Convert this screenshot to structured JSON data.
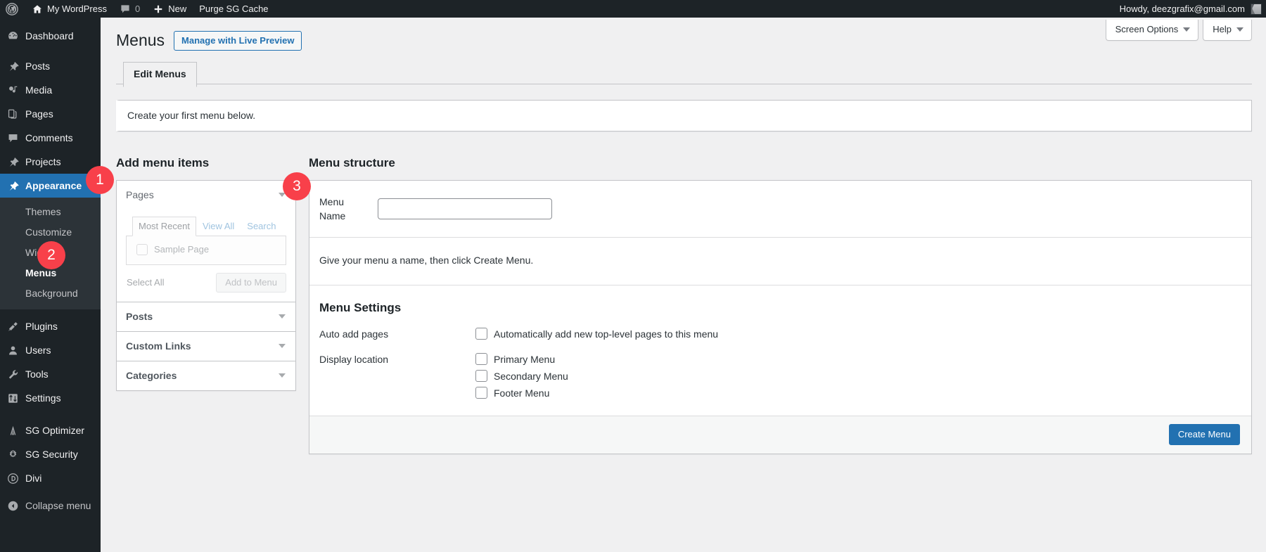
{
  "adminbar": {
    "logo_icon": "wordpress-logo-icon",
    "site_name": "My WordPress",
    "site_icon": "home-icon",
    "comments_icon": "comment-bubble-icon",
    "comments_count": "0",
    "new_icon": "plus-icon",
    "new_label": "New",
    "purge_label": "Purge SG Cache",
    "howdy": "Howdy, deezgrafix@gmail.com",
    "avatar": "user-avatar"
  },
  "sidebar": {
    "items": [
      {
        "label": "Dashboard",
        "icon": "dashboard-icon"
      },
      {
        "label": "Posts",
        "icon": "pin-icon"
      },
      {
        "label": "Media",
        "icon": "media-icon"
      },
      {
        "label": "Pages",
        "icon": "pages-icon"
      },
      {
        "label": "Comments",
        "icon": "comment-bubble-icon"
      },
      {
        "label": "Projects",
        "icon": "pin-icon"
      },
      {
        "label": "Appearance",
        "icon": "paintbrush-icon",
        "current": true
      },
      {
        "label": "Plugins",
        "icon": "plug-icon"
      },
      {
        "label": "Users",
        "icon": "user-icon"
      },
      {
        "label": "Tools",
        "icon": "wrench-icon"
      },
      {
        "label": "Settings",
        "icon": "settings-sliders-icon"
      },
      {
        "label": "SG Optimizer",
        "icon": "sg-optimizer-icon"
      },
      {
        "label": "SG Security",
        "icon": "gear-lock-icon"
      },
      {
        "label": "Divi",
        "icon": "divi-icon"
      }
    ],
    "appearance_submenu": [
      {
        "label": "Themes"
      },
      {
        "label": "Customize"
      },
      {
        "label": "Widgets"
      },
      {
        "label": "Menus",
        "current": true
      },
      {
        "label": "Background"
      }
    ],
    "collapse": {
      "label": "Collapse menu",
      "icon": "collapse-arrow-icon"
    }
  },
  "callouts": [
    {
      "number": "1"
    },
    {
      "number": "2"
    },
    {
      "number": "3"
    }
  ],
  "screen_meta": {
    "screen_options": "Screen Options",
    "help": "Help",
    "caret_icon": "caret-down-icon"
  },
  "header": {
    "title": "Menus",
    "live_preview_button": "Manage with Live Preview",
    "tabs": [
      {
        "label": "Edit Menus",
        "active": true
      }
    ]
  },
  "notice": {
    "text": "Create your first menu below."
  },
  "add_menu_items": {
    "heading": "Add menu items",
    "sections": [
      {
        "title": "Pages",
        "open": true,
        "caret_icon": "caret-down-icon",
        "tabs": [
          {
            "label": "Most Recent",
            "active": true
          },
          {
            "label": "View All",
            "active": false
          },
          {
            "label": "Search",
            "active": false
          }
        ],
        "items": [
          {
            "label": "Sample Page",
            "checked": false
          }
        ],
        "select_all": "Select All",
        "add_button": "Add to Menu"
      },
      {
        "title": "Posts",
        "open": false,
        "caret_icon": "caret-down-icon"
      },
      {
        "title": "Custom Links",
        "open": false,
        "caret_icon": "caret-down-icon"
      },
      {
        "title": "Categories",
        "open": false,
        "caret_icon": "caret-down-icon"
      }
    ]
  },
  "menu_structure": {
    "heading": "Menu structure",
    "menu_name_label": "Menu Name",
    "menu_name_value": "",
    "menu_name_placeholder": "",
    "instructions": "Give your menu a name, then click Create Menu.",
    "settings_title": "Menu Settings",
    "auto_add_label": "Auto add pages",
    "auto_add_option": {
      "label": "Automatically add new top-level pages to this menu",
      "checked": false
    },
    "display_location_label": "Display location",
    "display_locations": [
      {
        "label": "Primary Menu",
        "checked": false
      },
      {
        "label": "Secondary Menu",
        "checked": false
      },
      {
        "label": "Footer Menu",
        "checked": false
      }
    ],
    "create_button": "Create Menu"
  },
  "colors": {
    "admin_bar": "#1d2327",
    "sidebar": "#1d2327",
    "submenu": "#2c3338",
    "current_blue": "#2271b1",
    "callout_red": "#f8404a",
    "content_bg": "#f0f0f1"
  }
}
